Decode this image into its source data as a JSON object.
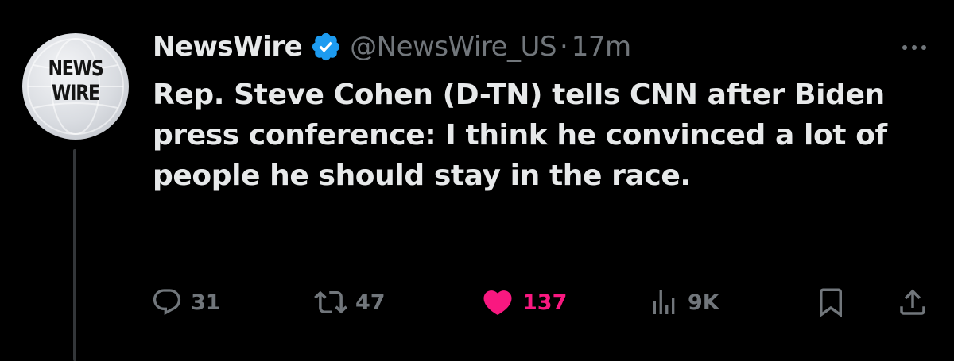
{
  "tweet": {
    "avatar": {
      "logo_line1": "NEWS",
      "logo_line2": "WIRE"
    },
    "display_name": "NewsWire",
    "verified": true,
    "handle": "@NewsWire_US",
    "separator": "·",
    "timestamp": "17m",
    "text": "Rep. Steve Cohen (D-TN) tells CNN after Biden press conference: I think he convinced a lot of people he should stay in the race.",
    "actions": {
      "replies": "31",
      "retweets": "47",
      "likes": "137",
      "views": "9K"
    },
    "liked": true
  },
  "colors": {
    "background": "#000000",
    "text_primary": "#e7e9ea",
    "text_secondary": "#71767b",
    "verified_badge": "#1d9bf0",
    "like_active": "#f91880",
    "thread_line": "#333639"
  },
  "icons": {
    "verified": "verified-badge-icon",
    "more": "more-horizontal-icon",
    "reply": "reply-icon",
    "retweet": "retweet-icon",
    "like": "heart-filled-icon",
    "views": "views-bar-chart-icon",
    "bookmark": "bookmark-icon",
    "share": "share-icon"
  }
}
